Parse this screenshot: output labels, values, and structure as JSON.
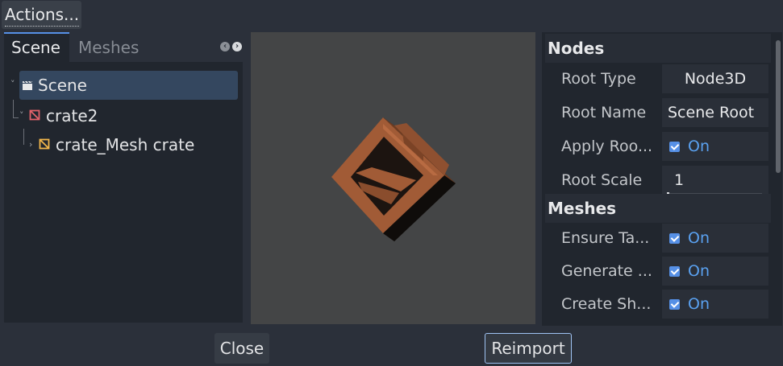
{
  "menu": {
    "actions_label": "Actions..."
  },
  "tabs": [
    {
      "label": "Scene",
      "active": true
    },
    {
      "label": "Meshes",
      "active": false
    }
  ],
  "tab_scroll_icons": [
    "chevron-left-icon",
    "chevron-right-icon"
  ],
  "tree": {
    "items": [
      {
        "label": "Scene",
        "icon": "clapperboard-icon",
        "selected": true
      },
      {
        "label": "crate2",
        "icon": "node3d-icon"
      },
      {
        "label": "crate_Mesh crate",
        "icon": "mesh-instance-icon"
      }
    ]
  },
  "inspector": {
    "sections": [
      {
        "title": "Nodes",
        "properties": [
          {
            "label": "Root Type",
            "value": "Node3D"
          },
          {
            "label": "Root Name",
            "value": "Scene Root"
          },
          {
            "label": "Apply Roo...",
            "value": "On",
            "checked": true
          },
          {
            "label": "Root Scale",
            "value": "1"
          }
        ]
      },
      {
        "title": "Meshes",
        "properties": [
          {
            "label": "Ensure Ta...",
            "value": "On",
            "checked": true
          },
          {
            "label": "Generate ...",
            "value": "On",
            "checked": true
          },
          {
            "label": "Create Sh...",
            "value": "On",
            "checked": true
          }
        ]
      }
    ]
  },
  "buttons": {
    "close_label": "Close",
    "reimport_label": "Reimport"
  },
  "colors": {
    "accent": "#5690e6",
    "crate_wood": "#a15b36",
    "node_icon": "#e5636b",
    "mesh_icon": "#f2b64b"
  }
}
